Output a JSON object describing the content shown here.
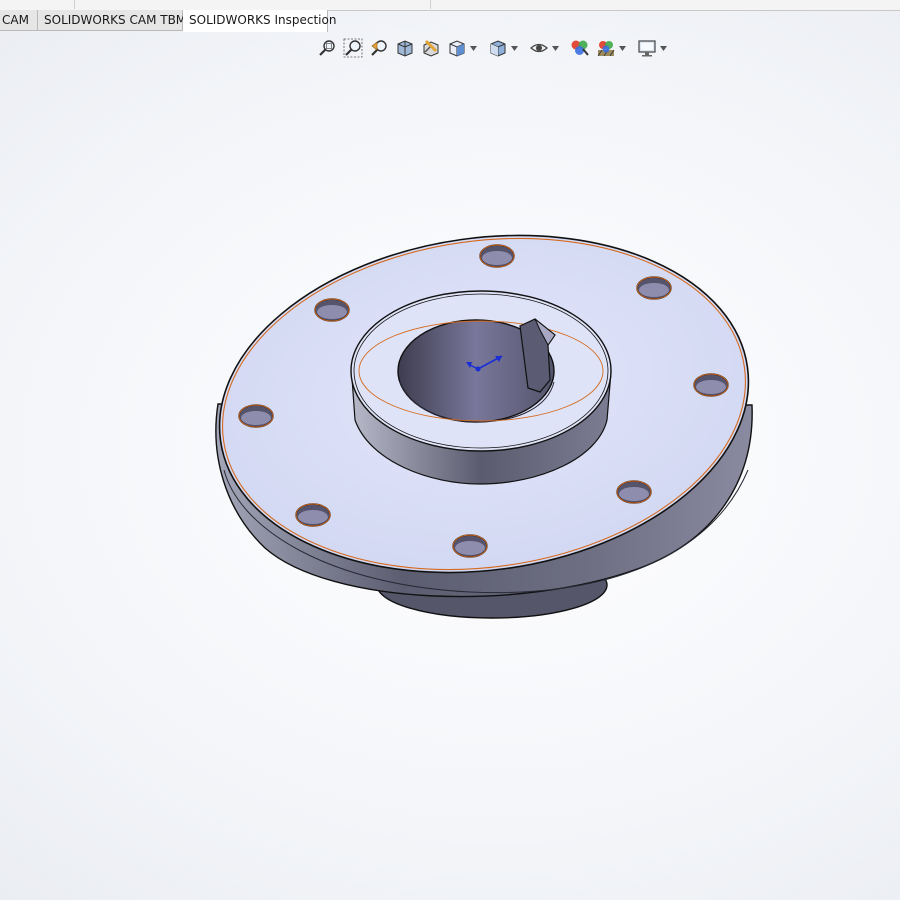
{
  "tabs": [
    {
      "label": "CAM",
      "active": false
    },
    {
      "label": "SOLIDWORKS CAM TBM",
      "active": false
    },
    {
      "label": "SOLIDWORKS Inspection",
      "active": true
    }
  ],
  "heads_up_toolbar": [
    {
      "icon": "zoom-to-fit-icon"
    },
    {
      "icon": "zoom-to-area-icon"
    },
    {
      "icon": "previous-view-icon"
    },
    {
      "icon": "section-view-icon"
    },
    {
      "icon": "dynamic-annotation-views-icon"
    },
    {
      "icon": "view-orientation-icon",
      "dropdown": true
    },
    {
      "icon": "display-style-icon",
      "dropdown": true
    },
    {
      "icon": "hide-show-items-icon",
      "dropdown": true
    },
    {
      "icon": "edit-appearance-icon"
    },
    {
      "icon": "apply-scene-icon",
      "dropdown": true
    },
    {
      "icon": "view-settings-icon",
      "dropdown": true
    }
  ],
  "colors": {
    "face_top": "#dadff6",
    "face_side": "#6a6b7e",
    "edge_highlight": "#d46a1e",
    "triad": "#1a2ed6"
  }
}
